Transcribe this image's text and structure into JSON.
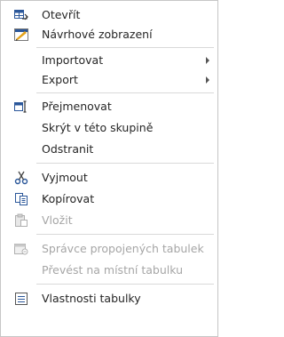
{
  "menu": {
    "items": [
      {
        "label": "Otevřít",
        "icon": "open-table-icon",
        "enabled": true
      },
      {
        "label": "Návrhové zobrazení",
        "icon": "design-view-icon",
        "enabled": true
      },
      {
        "label": "Importovat",
        "enabled": true,
        "submenu": true
      },
      {
        "label": "Export",
        "enabled": true,
        "submenu": true
      },
      {
        "label": "Přejmenovat",
        "icon": "rename-icon",
        "enabled": true
      },
      {
        "label": "Skrýt v této skupině",
        "enabled": true
      },
      {
        "label": "Odstranit",
        "enabled": true
      },
      {
        "label": "Vyjmout",
        "icon": "scissors-icon",
        "enabled": true
      },
      {
        "label": "Kopírovat",
        "icon": "copy-icon",
        "enabled": true
      },
      {
        "label": "Vložit",
        "icon": "paste-icon",
        "enabled": false
      },
      {
        "label": "Správce propojených tabulek",
        "icon": "linked-table-manager-icon",
        "enabled": false
      },
      {
        "label": "Převést na místní tabulku",
        "enabled": false
      },
      {
        "label": "Vlastnosti tabulky",
        "icon": "table-properties-icon",
        "enabled": true
      }
    ]
  },
  "colors": {
    "text": "#262626",
    "disabled_text": "#a6a6a6",
    "separator": "#d9d9d9",
    "border": "#c6c6c6"
  }
}
